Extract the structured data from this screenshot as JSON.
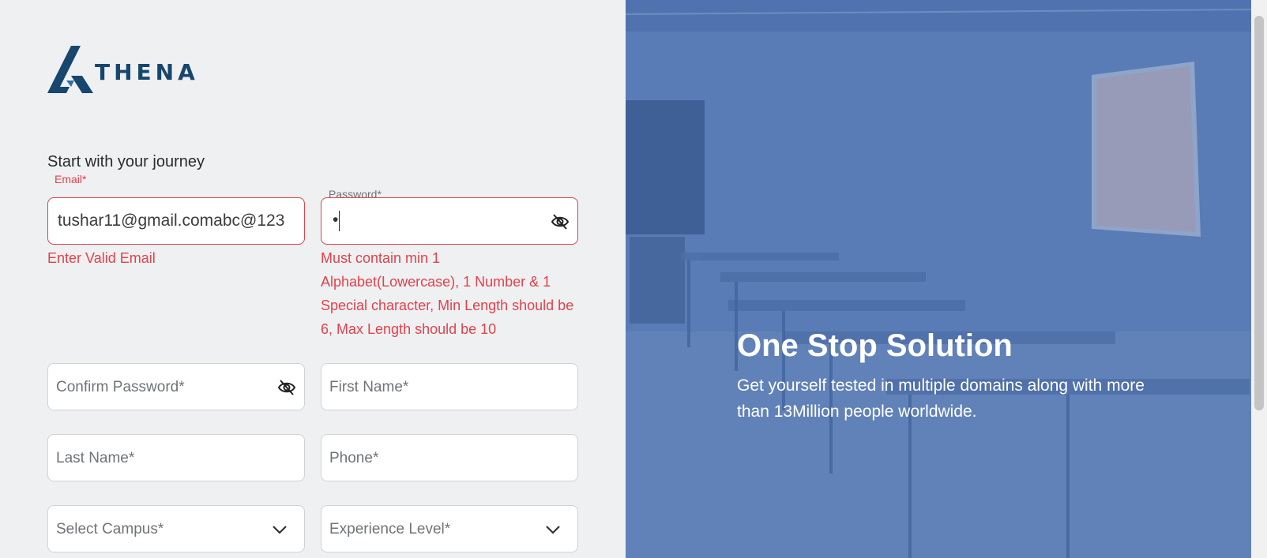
{
  "brand": {
    "name": "THENA",
    "primary_color": "#17466e"
  },
  "form": {
    "subtitle": "Start with your journey",
    "error_color": "#e0434b",
    "email": {
      "label": "Email*",
      "value": "tushar11@gmail.comabc@123",
      "error": "Enter Valid Email"
    },
    "password": {
      "label": "Password*",
      "value": "•",
      "error": "Must contain min 1 Alphabet(Lowercase), 1 Number & 1 Special character, Min Length should be 6, Max Length should be 10",
      "toggle_icon": "eye-off-icon"
    },
    "confirm_password": {
      "placeholder": "Confirm Password*",
      "toggle_icon": "eye-off-icon"
    },
    "first_name": {
      "placeholder": "First Name*"
    },
    "last_name": {
      "placeholder": "Last Name*"
    },
    "phone": {
      "placeholder": "Phone*"
    },
    "campus": {
      "placeholder": "Select Campus*",
      "icon": "chevron-down-icon"
    },
    "experience": {
      "placeholder": "Experience Level*",
      "icon": "chevron-down-icon"
    }
  },
  "hero": {
    "title": "One Stop Solution",
    "subtitle": "Get yourself tested in multiple domains along with more than 13Million people worldwide."
  }
}
